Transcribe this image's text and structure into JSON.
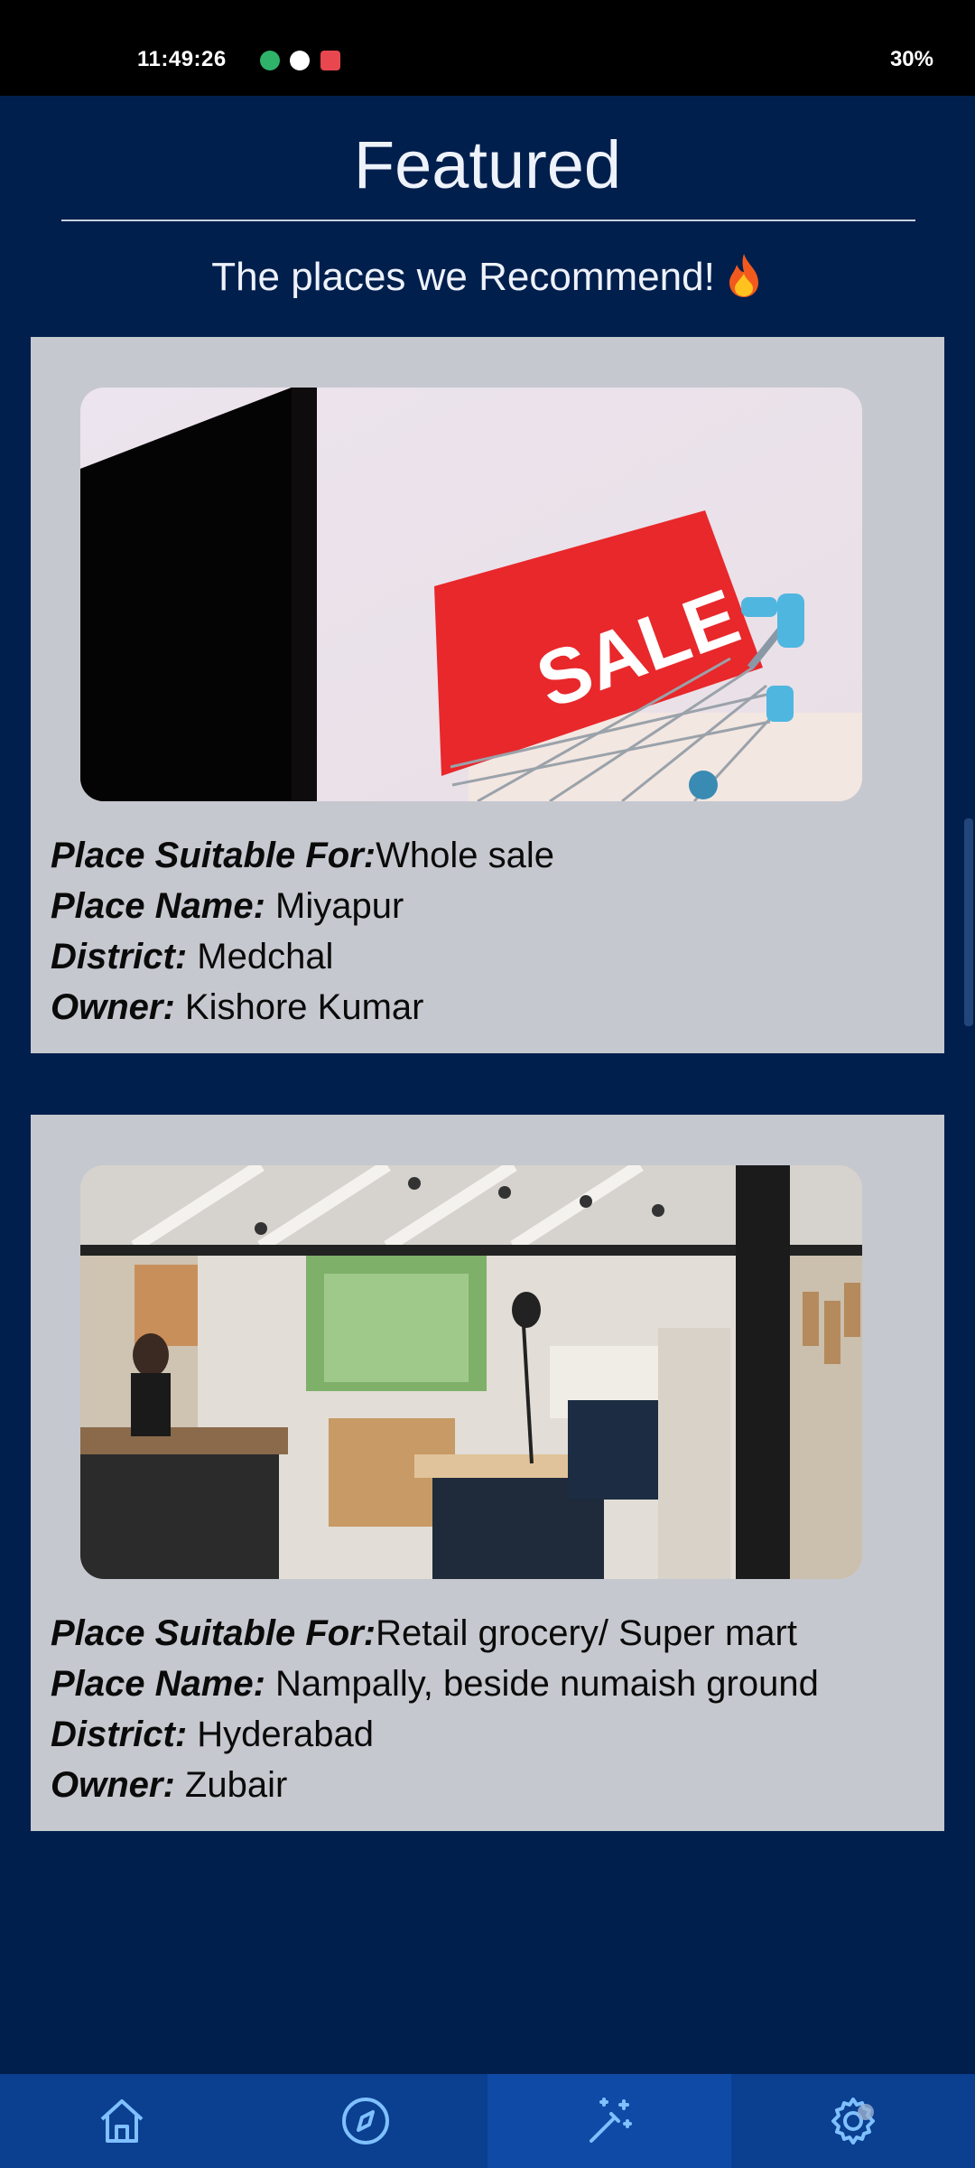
{
  "status": {
    "time": "11:49:26",
    "battery": "30%"
  },
  "header": {
    "title": "Featured",
    "subtitle": "The places we Recommend!"
  },
  "cards": [
    {
      "image": "sale-shopping-cart-photo",
      "image_text": "SALE",
      "suitable_label": "Place Suitable For:",
      "suitable_value": "Whole sale",
      "name_label": "Place Name:",
      "name_value": " Miyapur",
      "district_label": "District:",
      "district_value": " Medchal",
      "owner_label": "Owner:",
      "owner_value": " Kishore Kumar"
    },
    {
      "image": "retail-store-interior-photo",
      "suitable_label": "Place Suitable For:",
      "suitable_value": "Retail grocery/ Super mart",
      "name_label": "Place Name:",
      "name_value": " Nampally, beside numaish ground",
      "district_label": "District:",
      "district_value": " Hyderabad",
      "owner_label": "Owner:",
      "owner_value": " Zubair"
    }
  ],
  "nav": [
    {
      "icon": "home-icon",
      "active": false
    },
    {
      "icon": "compass-icon",
      "active": false
    },
    {
      "icon": "magic-wand-icon",
      "active": true
    },
    {
      "icon": "settings-gear-icon",
      "active": false
    }
  ],
  "colors": {
    "background": "#001f4d",
    "card": "#c6c8cf",
    "nav": "#0b3f90",
    "nav_active": "#0f4aa6",
    "sale_tag": "#e8282b"
  }
}
